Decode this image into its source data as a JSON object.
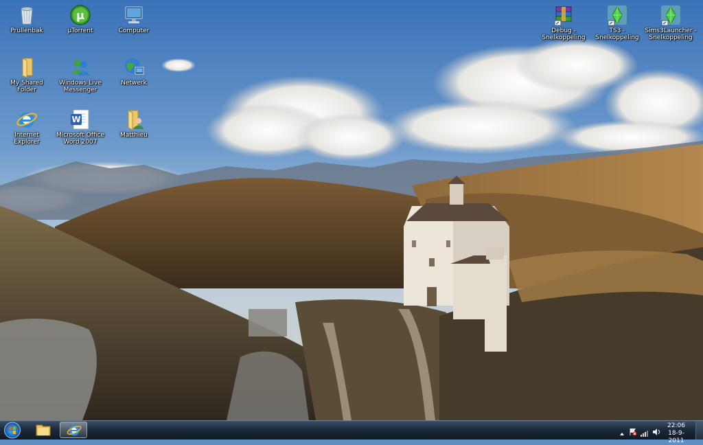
{
  "desktop": {
    "icons": [
      {
        "label": "Prullenbak",
        "icon": "recycle-bin-icon"
      },
      {
        "label": "µTorrent",
        "icon": "utorrent-icon"
      },
      {
        "label": "Computer",
        "icon": "computer-icon"
      },
      {
        "label": "My Shared Folder",
        "icon": "folder-icon"
      },
      {
        "label": "Windows Live Messenger",
        "icon": "messenger-icon"
      },
      {
        "label": "Netwerk",
        "icon": "network-icon"
      },
      {
        "label": "Internet Explorer",
        "icon": "internet-explorer-icon"
      },
      {
        "label": "Microsoft Office Word 2007",
        "icon": "word-icon"
      },
      {
        "label": "Matthieu",
        "icon": "user-folder-icon"
      },
      {
        "label": "Debug - Snelkoppeling",
        "icon": "winrar-icon"
      },
      {
        "label": "TS3 - Snelkoppeling",
        "icon": "sims-plumbob-icon"
      },
      {
        "label": "Sims3Launcher - Snelkoppeling",
        "icon": "sims-plumbob-icon"
      }
    ]
  },
  "taskbar": {
    "start": "start-orb-icon",
    "pinned": [
      {
        "name": "explorer",
        "icon": "folder-icon"
      },
      {
        "name": "internet-explorer",
        "icon": "internet-explorer-icon",
        "active": true
      }
    ],
    "tray": {
      "icons": [
        "tray-up-arrow-icon",
        "action-center-flag-icon",
        "signal-bars-icon",
        "speaker-icon"
      ]
    },
    "clock": {
      "time": "22:06",
      "date": "18-9-2011"
    }
  },
  "colors": {
    "sky_top": "#3f78bd",
    "sky_bottom": "#bcd0e2",
    "hills": "#6b4f30",
    "taskbar": "#1c2a3a"
  }
}
